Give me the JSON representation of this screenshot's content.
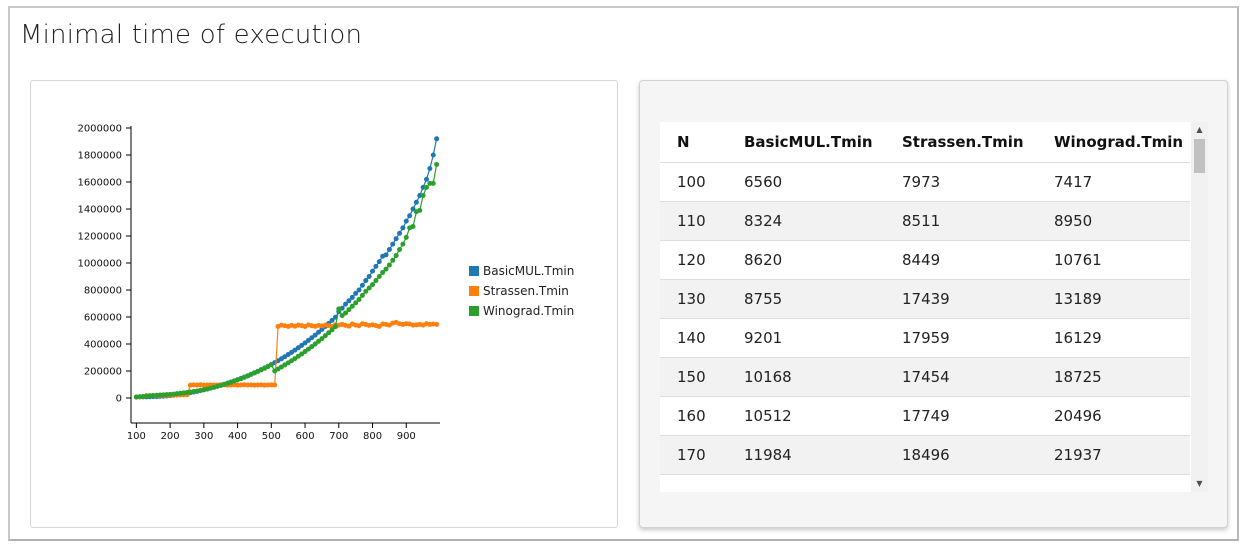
{
  "page": {
    "title": "Minimal time of execution"
  },
  "colors": {
    "basic": "#1f77b4",
    "strassen": "#ff7f0e",
    "winograd": "#2ca02c"
  },
  "chart_data": {
    "type": "line",
    "title": "",
    "xlabel": "",
    "ylabel": "",
    "xlim": [
      90,
      1000
    ],
    "ylim": [
      0,
      2000000
    ],
    "x_ticks": [
      100,
      200,
      300,
      400,
      500,
      600,
      700,
      800,
      900
    ],
    "y_ticks": [
      0,
      200000,
      400000,
      600000,
      800000,
      1000000,
      1200000,
      1400000,
      1600000,
      1800000,
      2000000
    ],
    "legend_position": "right",
    "x": [
      100,
      110,
      120,
      130,
      140,
      150,
      160,
      170,
      180,
      190,
      200,
      210,
      220,
      230,
      240,
      250,
      260,
      270,
      280,
      290,
      300,
      310,
      320,
      330,
      340,
      350,
      360,
      370,
      380,
      390,
      400,
      410,
      420,
      430,
      440,
      450,
      460,
      470,
      480,
      490,
      500,
      510,
      520,
      530,
      540,
      550,
      560,
      570,
      580,
      590,
      600,
      610,
      620,
      630,
      640,
      650,
      660,
      670,
      680,
      690,
      700,
      710,
      720,
      730,
      740,
      750,
      760,
      770,
      780,
      790,
      800,
      810,
      820,
      830,
      840,
      850,
      860,
      870,
      880,
      890,
      900,
      910,
      920,
      930,
      940,
      950,
      960,
      970,
      980,
      990
    ],
    "series": [
      {
        "name": "BasicMUL.Tmin",
        "color": "#1f77b4",
        "values": [
          6560,
          8324,
          8620,
          8755,
          9201,
          10168,
          10512,
          11984,
          13000,
          15000,
          17000,
          20000,
          23000,
          27000,
          31000,
          35000,
          39000,
          44000,
          49000,
          55000,
          60000,
          66000,
          73000,
          80000,
          87000,
          94000,
          102000,
          110000,
          118000,
          127000,
          136000,
          145000,
          155000,
          165000,
          176000,
          187000,
          198000,
          210000,
          222000,
          235000,
          248000,
          262000,
          276000,
          291000,
          306000,
          322000,
          338000,
          355000,
          372000,
          390000,
          408000,
          427000,
          446000,
          466000,
          487000,
          508000,
          530000,
          552000,
          575000,
          598000,
          640000,
          665000,
          695000,
          720000,
          745000,
          775000,
          800000,
          835000,
          870000,
          900000,
          940000,
          975000,
          1010000,
          1050000,
          1060000,
          1100000,
          1140000,
          1180000,
          1220000,
          1260000,
          1310000,
          1350000,
          1400000,
          1450000,
          1500000,
          1560000,
          1620000,
          1700000,
          1800000,
          1920000
        ]
      },
      {
        "name": "Strassen.Tmin",
        "color": "#ff7f0e",
        "values": [
          7973,
          8511,
          8449,
          17439,
          17959,
          17454,
          17749,
          18496,
          19000,
          19500,
          20000,
          21000,
          21500,
          22000,
          23000,
          24000,
          95000,
          97000,
          96000,
          98000,
          95000,
          96000,
          97000,
          95000,
          96000,
          98000,
          97000,
          95000,
          96000,
          97000,
          95000,
          96000,
          98000,
          96000,
          97000,
          95000,
          96000,
          97000,
          95000,
          96000,
          97000,
          96000,
          530000,
          540000,
          535000,
          530000,
          538000,
          532000,
          540000,
          536000,
          530000,
          542000,
          535000,
          531000,
          538000,
          534000,
          540000,
          536000,
          530000,
          542000,
          540000,
          545000,
          538000,
          532000,
          548000,
          540000,
          535000,
          550000,
          545000,
          538000,
          542000,
          536000,
          530000,
          548000,
          545000,
          540000,
          555000,
          560000,
          550000,
          545000,
          550000,
          548000,
          540000,
          542000,
          545000,
          540000,
          550000,
          545000,
          548000,
          545000
        ]
      },
      {
        "name": "Winograd.Tmin",
        "color": "#2ca02c",
        "values": [
          7417,
          8950,
          10761,
          13189,
          16129,
          18725,
          20496,
          21937,
          23500,
          25000,
          27000,
          29000,
          32000,
          35000,
          38000,
          41000,
          44000,
          48000,
          52000,
          57000,
          62000,
          67000,
          73000,
          79000,
          86000,
          93000,
          100000,
          108000,
          116000,
          125000,
          134000,
          143000,
          153000,
          163000,
          174000,
          185000,
          196000,
          208000,
          220000,
          233000,
          246000,
          200000,
          215000,
          230000,
          245000,
          260000,
          276000,
          292000,
          309000,
          326000,
          344000,
          362000,
          381000,
          400000,
          420000,
          440000,
          461000,
          483000,
          505000,
          528000,
          660000,
          610000,
          630000,
          655000,
          680000,
          705000,
          730000,
          760000,
          790000,
          815000,
          840000,
          870000,
          900000,
          930000,
          955000,
          985000,
          1020000,
          1055000,
          1100000,
          1140000,
          1190000,
          1260000,
          1270000,
          1380000,
          1390000,
          1500000,
          1560000,
          1590000,
          1590000,
          1730000
        ]
      }
    ]
  },
  "table": {
    "headers": [
      "N",
      "BasicMUL.Tmin",
      "Strassen.Tmin",
      "Winograd.Tmin"
    ],
    "rows": [
      [
        "100",
        "6560",
        "7973",
        "7417"
      ],
      [
        "110",
        "8324",
        "8511",
        "8950"
      ],
      [
        "120",
        "8620",
        "8449",
        "10761"
      ],
      [
        "130",
        "8755",
        "17439",
        "13189"
      ],
      [
        "140",
        "9201",
        "17959",
        "16129"
      ],
      [
        "150",
        "10168",
        "17454",
        "18725"
      ],
      [
        "160",
        "10512",
        "17749",
        "20496"
      ],
      [
        "170",
        "11984",
        "18496",
        "21937"
      ]
    ]
  }
}
